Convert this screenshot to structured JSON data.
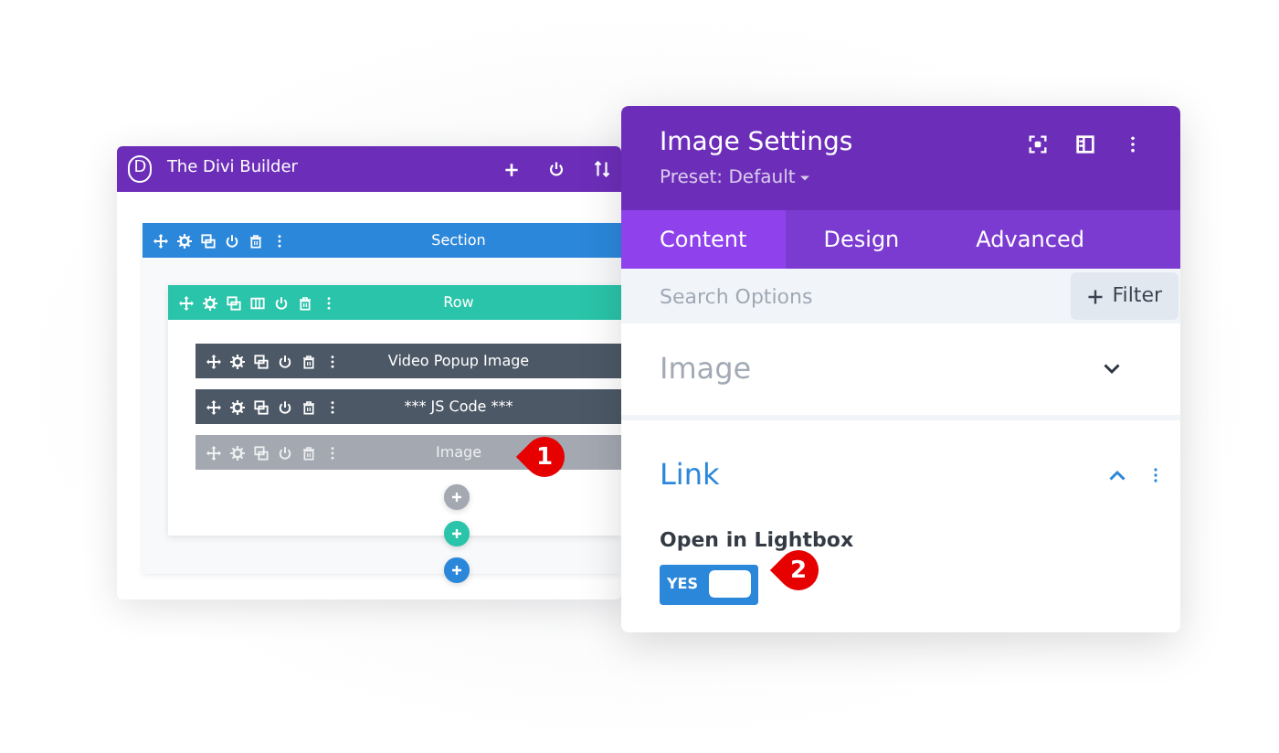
{
  "builder": {
    "logo": "D",
    "title": "The Divi Builder",
    "section": {
      "label": "Section"
    },
    "row": {
      "label": "Row"
    },
    "modules": [
      {
        "label": "Video Popup Image",
        "kind": "dark"
      },
      {
        "label": "*** JS Code ***",
        "kind": "dark"
      },
      {
        "label": "Image",
        "kind": "light"
      }
    ],
    "add_buttons": [
      {
        "color": "#a3a8b1"
      },
      {
        "color": "#29c4a9"
      },
      {
        "color": "#2b87da"
      }
    ]
  },
  "settings": {
    "title": "Image Settings",
    "preset": "Preset: Default",
    "tabs": [
      {
        "label": "Content",
        "selected": true
      },
      {
        "label": "Design",
        "selected": false
      },
      {
        "label": "Advanced",
        "selected": false
      }
    ],
    "search": {
      "placeholder": "Search Options"
    },
    "filter_button": "Filter",
    "groups": [
      {
        "title": "Image",
        "expanded": false
      },
      {
        "title": "Link",
        "expanded": true,
        "fields": [
          {
            "label": "Open in Lightbox",
            "kind": "toggle",
            "on": true,
            "value_label": "YES"
          }
        ]
      }
    ]
  },
  "markers": [
    {
      "number": "1"
    },
    {
      "number": "2"
    }
  ]
}
